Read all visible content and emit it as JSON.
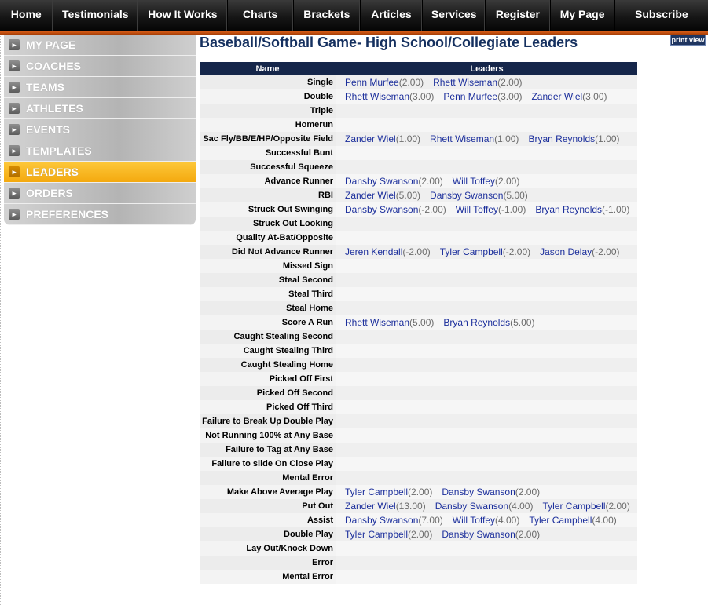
{
  "nav": {
    "items": [
      {
        "label": "Home",
        "width": 69
      },
      {
        "label": "Testimonials",
        "width": 111
      },
      {
        "label": "How It Works",
        "width": 116
      },
      {
        "label": "Charts",
        "width": 86
      },
      {
        "label": "Brackets",
        "width": 87
      },
      {
        "label": "Articles",
        "width": 81
      },
      {
        "label": "Services",
        "width": 82
      },
      {
        "label": "Register",
        "width": 84
      },
      {
        "label": "My Page",
        "width": 84
      },
      {
        "label": "Subscribe",
        "width": 121
      }
    ]
  },
  "sidebar": {
    "items": [
      {
        "label": "MY PAGE",
        "active": false
      },
      {
        "label": "COACHES",
        "active": false
      },
      {
        "label": "TEAMS",
        "active": false
      },
      {
        "label": "ATHLETES",
        "active": false
      },
      {
        "label": "EVENTS",
        "active": false
      },
      {
        "label": "TEMPLATES",
        "active": false
      },
      {
        "label": "LEADERS",
        "active": true
      },
      {
        "label": "ORDERS",
        "active": false
      },
      {
        "label": "PREFERENCES",
        "active": false
      }
    ]
  },
  "page": {
    "title": "Baseball/Softball Game- High School/Collegiate Leaders",
    "print_view": "print view"
  },
  "table": {
    "headers": {
      "name": "Name",
      "leaders": "Leaders"
    },
    "rows": [
      {
        "category": "Single",
        "leaders": [
          {
            "name": "Penn Murfee",
            "score": "(2.00)"
          },
          {
            "name": "Rhett Wiseman",
            "score": "(2.00)"
          }
        ]
      },
      {
        "category": "Double",
        "leaders": [
          {
            "name": "Rhett Wiseman",
            "score": "(3.00)"
          },
          {
            "name": "Penn Murfee",
            "score": "(3.00)"
          },
          {
            "name": "Zander Wiel",
            "score": "(3.00)"
          }
        ]
      },
      {
        "category": "Triple",
        "leaders": []
      },
      {
        "category": "Homerun",
        "leaders": []
      },
      {
        "category": "Sac Fly/BB/E/HP/Opposite Field",
        "leaders": [
          {
            "name": "Zander Wiel",
            "score": "(1.00)"
          },
          {
            "name": "Rhett Wiseman",
            "score": "(1.00)"
          },
          {
            "name": "Bryan Reynolds",
            "score": "(1.00)"
          }
        ]
      },
      {
        "category": "Successful Bunt",
        "leaders": []
      },
      {
        "category": "Successful Squeeze",
        "leaders": []
      },
      {
        "category": "Advance Runner",
        "leaders": [
          {
            "name": "Dansby Swanson",
            "score": "(2.00)"
          },
          {
            "name": "Will Toffey",
            "score": "(2.00)"
          }
        ]
      },
      {
        "category": "RBI",
        "leaders": [
          {
            "name": "Zander Wiel",
            "score": "(5.00)"
          },
          {
            "name": "Dansby Swanson",
            "score": "(5.00)"
          }
        ]
      },
      {
        "category": "Struck Out Swinging",
        "leaders": [
          {
            "name": "Dansby Swanson",
            "score": "(-2.00)"
          },
          {
            "name": "Will Toffey",
            "score": "(-1.00)"
          },
          {
            "name": "Bryan Reynolds",
            "score": "(-1.00)"
          }
        ]
      },
      {
        "category": "Struck Out Looking",
        "leaders": []
      },
      {
        "category": "Quality At-Bat/Opposite",
        "leaders": []
      },
      {
        "category": "Did Not Advance Runner",
        "leaders": [
          {
            "name": "Jeren Kendall",
            "score": "(-2.00)"
          },
          {
            "name": "Tyler Campbell",
            "score": "(-2.00)"
          },
          {
            "name": "Jason Delay",
            "score": "(-2.00)"
          }
        ]
      },
      {
        "category": "Missed Sign",
        "leaders": []
      },
      {
        "category": "Steal Second",
        "leaders": []
      },
      {
        "category": "Steal Third",
        "leaders": []
      },
      {
        "category": "Steal Home",
        "leaders": []
      },
      {
        "category": "Score A Run",
        "leaders": [
          {
            "name": "Rhett Wiseman",
            "score": "(5.00)"
          },
          {
            "name": "Bryan Reynolds",
            "score": "(5.00)"
          }
        ]
      },
      {
        "category": "Caught Stealing Second",
        "leaders": []
      },
      {
        "category": "Caught Stealing Third",
        "leaders": []
      },
      {
        "category": "Caught Stealing Home",
        "leaders": []
      },
      {
        "category": "Picked Off First",
        "leaders": []
      },
      {
        "category": "Picked Off Second",
        "leaders": []
      },
      {
        "category": "Picked Off Third",
        "leaders": []
      },
      {
        "category": "Failure to Break Up Double Play",
        "leaders": []
      },
      {
        "category": "Not Running 100% at Any Base",
        "leaders": []
      },
      {
        "category": "Failure to Tag at Any Base",
        "leaders": []
      },
      {
        "category": "Failure to slide On Close Play",
        "leaders": []
      },
      {
        "category": "Mental Error",
        "leaders": []
      },
      {
        "category": "Make Above Average Play",
        "leaders": [
          {
            "name": "Tyler Campbell",
            "score": "(2.00)"
          },
          {
            "name": "Dansby Swanson",
            "score": "(2.00)"
          }
        ]
      },
      {
        "category": "Put Out",
        "leaders": [
          {
            "name": "Zander Wiel",
            "score": "(13.00)"
          },
          {
            "name": "Dansby Swanson",
            "score": "(4.00)"
          },
          {
            "name": "Tyler Campbell",
            "score": "(2.00)"
          }
        ]
      },
      {
        "category": "Assist",
        "leaders": [
          {
            "name": "Dansby Swanson",
            "score": "(7.00)"
          },
          {
            "name": "Will Toffey",
            "score": "(4.00)"
          },
          {
            "name": "Tyler Campbell",
            "score": "(4.00)"
          }
        ]
      },
      {
        "category": "Double Play",
        "leaders": [
          {
            "name": "Tyler Campbell",
            "score": "(2.00)"
          },
          {
            "name": "Dansby Swanson",
            "score": "(2.00)"
          }
        ]
      },
      {
        "category": "Lay Out/Knock Down",
        "leaders": []
      },
      {
        "category": "Error",
        "leaders": []
      },
      {
        "category": "Mental Error",
        "leaders": []
      }
    ]
  }
}
